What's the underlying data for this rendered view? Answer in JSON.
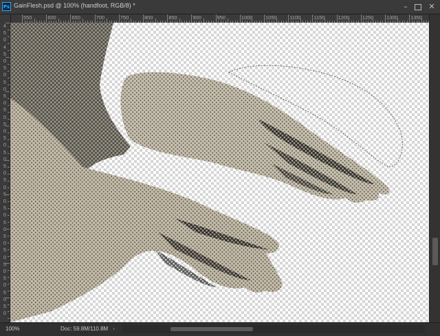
{
  "app": {
    "logo_text": "Ps"
  },
  "document": {
    "title": "GainFlesh.psd @ 100% (handfoot, RGB/8) *"
  },
  "window_controls": {
    "minimize": "–",
    "close": "✕"
  },
  "ruler": {
    "top_labels": [
      "550",
      "600",
      "650",
      "700",
      "750",
      "800",
      "850",
      "900",
      "950",
      "1000",
      "1050",
      "1100",
      "1150",
      "1200",
      "1250",
      "1300",
      "1350"
    ],
    "left_labels": [
      "4",
      "5",
      "0",
      "4",
      "5",
      "0",
      "5",
      "0",
      "5",
      "0",
      "5",
      "0",
      "5",
      "0",
      "5",
      "0",
      "5",
      "0",
      "5",
      "0",
      "5",
      "0",
      "5",
      "0",
      "5",
      "0",
      "5",
      "0",
      "5",
      "0",
      "5",
      "0",
      "5",
      "0",
      "5",
      "0",
      "5",
      "0",
      "5",
      "0",
      "5",
      "0"
    ]
  },
  "status": {
    "zoom": "100%",
    "doc": "Doc: 59.8M/110.8M",
    "arrow": "›"
  },
  "icons": {
    "ps_logo": "photoshop-logo-icon",
    "minimize": "minimize-icon",
    "maximize": "maximize-icon",
    "close": "close-icon"
  },
  "colors": {
    "accent": "#31a8ff",
    "skin": "#bfb6a2",
    "dots": "#2c2c2a"
  }
}
